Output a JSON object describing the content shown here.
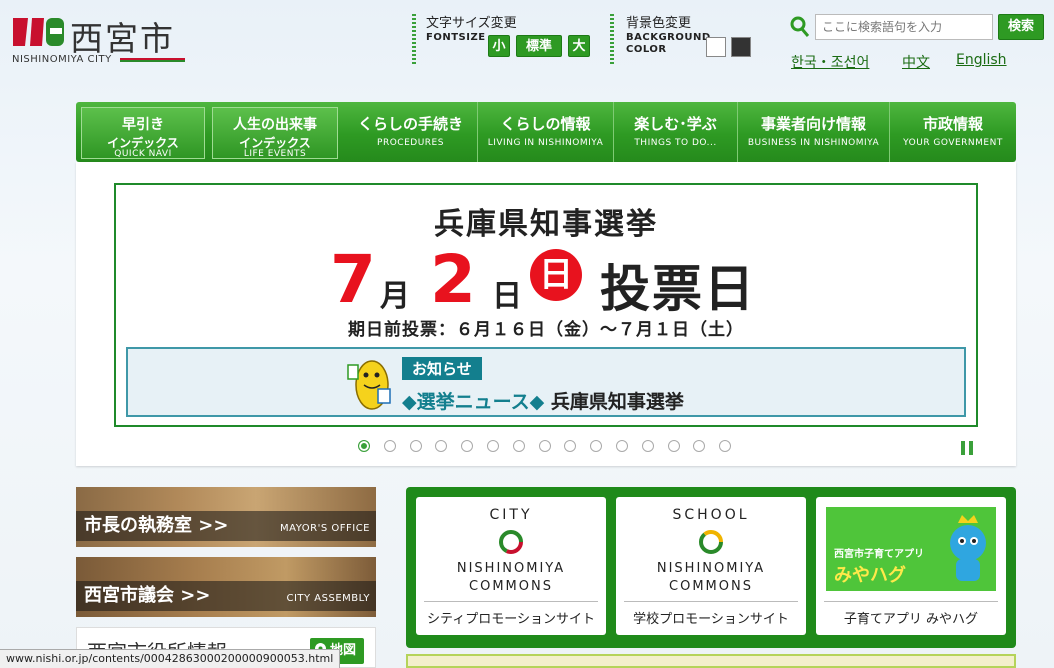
{
  "header": {
    "logo_text": "西宮市",
    "logo_sub": "NISHINOMIYA CITY",
    "fontsize": {
      "title": "文字サイズ変更",
      "sub": "FONTSIZE",
      "buttons": [
        "小",
        "標準",
        "大"
      ]
    },
    "bgcolor": {
      "title": "背景色変更",
      "sub_line1": "BACKGROUND",
      "sub_line2": "COLOR",
      "swatches": [
        "#ffffff",
        "#333333"
      ]
    },
    "search": {
      "placeholder": "ここに検索語句を入力",
      "button": "検索"
    },
    "languages": [
      "한국・조선어",
      "中文",
      "English"
    ]
  },
  "nav": {
    "quick": [
      {
        "jp": "早引き",
        "jp2": "インデックス",
        "en": "QUICK NAVI"
      },
      {
        "jp": "人生の出来事",
        "jp2": "インデックス",
        "en": "LIFE EVENTS"
      }
    ],
    "items": [
      {
        "jp": "くらしの手続き",
        "en": "PROCEDURES"
      },
      {
        "jp": "くらしの情報",
        "en": "LIVING IN NISHINOMIYA"
      },
      {
        "jp": "楽しむ･学ぶ",
        "en": "THINGS TO DO..."
      },
      {
        "jp": "事業者向け情報",
        "en": "BUSINESS IN NISHINOMIYA"
      },
      {
        "jp": "市政情報",
        "en": "YOUR GOVERNMENT"
      }
    ]
  },
  "banner": {
    "title": "兵庫県知事選挙",
    "month_num": "7",
    "month_unit": "月",
    "day_num": "2",
    "day_unit": "日",
    "weekday": "日",
    "vote_day": "投票日",
    "early_vote": "期日前投票：６月１６日（金）～７月１日（土）",
    "notice_tag": "お知らせ",
    "notice_link": "◆選挙ニュース◆",
    "notice_text": "兵庫県知事選挙",
    "slide_count": 15,
    "active_slide": 1,
    "accent_red": "#e8121e",
    "accent_green": "#1f8a2a"
  },
  "side": {
    "mayor": {
      "jp": "市長の執務室 >>",
      "en": "MAYOR'S OFFICE"
    },
    "assembly": {
      "jp": "西宮市議会 >>",
      "en": "CITY ASSEMBLY"
    },
    "info_title": "西宮市役所情報",
    "map_button": "地図"
  },
  "promos": [
    {
      "head": "CITY",
      "name1": "NISHINOMIYA",
      "name2": "COMMONS",
      "caption": "シティプロモーションサイト"
    },
    {
      "head": "SCHOOL",
      "name1": "NISHINOMIYA",
      "name2": "COMMONS",
      "caption": "学校プロモーションサイト"
    },
    {
      "app_small": "西宮市子育てアプリ",
      "app_big": "みやハグ",
      "caption": "子育てアプリ みやハグ"
    }
  ],
  "status_url": "www.nishi.or.jp/contents/00042863000200000900053.html"
}
